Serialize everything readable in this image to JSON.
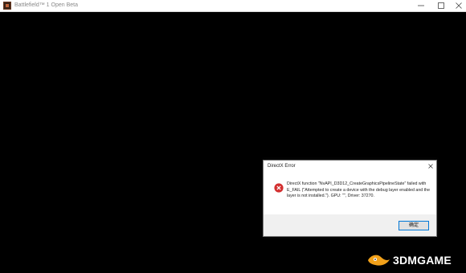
{
  "window": {
    "title": "Battlefield™ 1 Open Beta",
    "icon": "app-icon"
  },
  "dialog": {
    "title": "DirectX Error",
    "icon": "error-icon",
    "message": "DirectX function \"NvAPI_D3D12_CreateGraphicsPipelineState\" failed with E_FAIL (\"Attempted to create a device with the debug layer enabled and the layer is not installed.\"). GPU: \"\", Driver: 37270.",
    "ok_label": "确定"
  },
  "watermark": {
    "text": "3DMGAME"
  },
  "colors": {
    "accent": "#0078d7",
    "error": "#d32f2f",
    "background": "#000000"
  }
}
